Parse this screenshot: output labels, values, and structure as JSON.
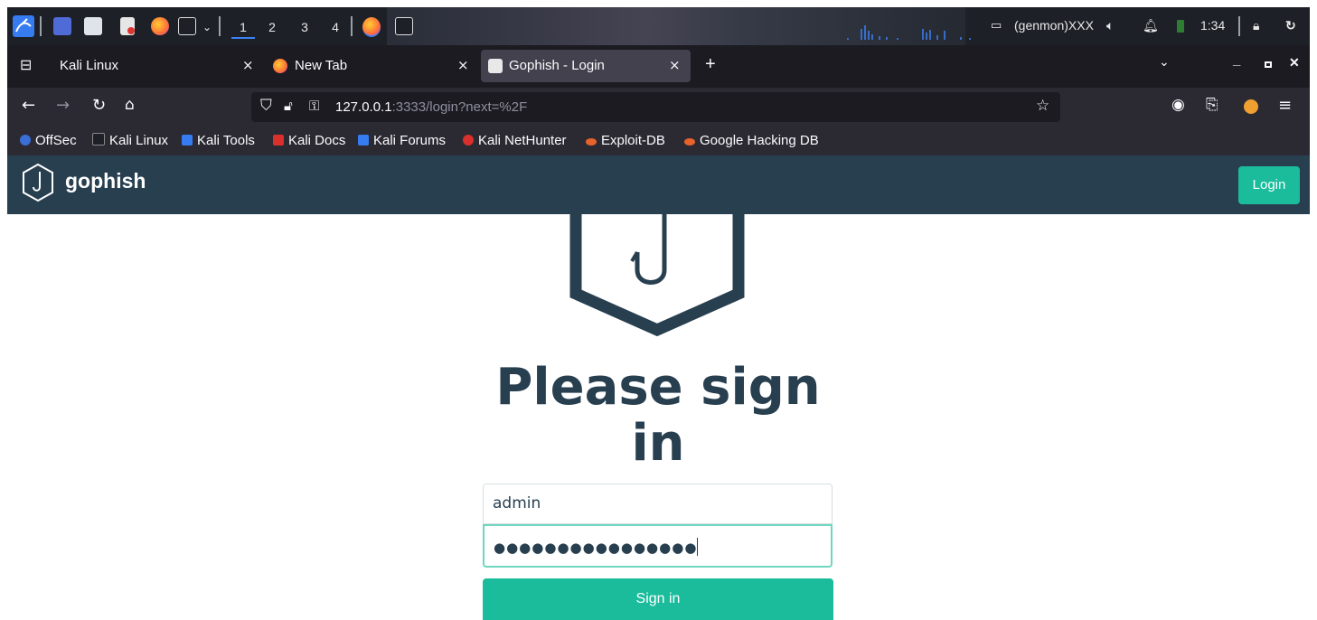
{
  "taskbar": {
    "workspaces": [
      "1",
      "2",
      "3",
      "4"
    ],
    "genmon_label": "(genmon)XXX",
    "clock": "1:34"
  },
  "browser": {
    "tabs": [
      {
        "label": "Kali Linux",
        "close": "×"
      },
      {
        "label": "New Tab",
        "close": "×"
      },
      {
        "label": "Gophish - Login",
        "close": "×"
      }
    ],
    "new_tab": "+",
    "url_host": "127.0.0.1",
    "url_rest": ":3333/login?next=%2F",
    "bookmarks": [
      "OffSec",
      "Kali Linux",
      "Kali Tools",
      "Kali Docs",
      "Kali Forums",
      "Kali NetHunter",
      "Exploit-DB",
      "Google Hacking DB"
    ]
  },
  "app": {
    "brand": "gophish",
    "nav_login": "Login",
    "heading": "Please sign in",
    "username_value": "admin",
    "password_mask": "●●●●●●●●●●●●●●●●",
    "signin_label": "Sign in",
    "accent_color": "#1abc9c",
    "primary_color": "#283f50"
  }
}
